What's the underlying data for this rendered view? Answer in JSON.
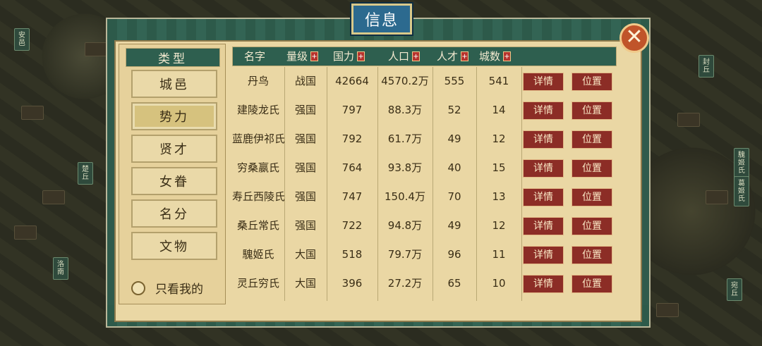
{
  "title": "信息",
  "close_icon": "close-icon",
  "sidebar": {
    "header": "类型",
    "categories": [
      "城邑",
      "势力",
      "贤才",
      "女眷",
      "名分",
      "文物"
    ],
    "active": "势力",
    "only_mine_label": "只看我的"
  },
  "table": {
    "columns": [
      {
        "label": "名字",
        "sortable": false
      },
      {
        "label": "量级",
        "sortable": true
      },
      {
        "label": "国力",
        "sortable": true
      },
      {
        "label": "人口",
        "sortable": true
      },
      {
        "label": "人才",
        "sortable": true
      },
      {
        "label": "城数",
        "sortable": true
      }
    ],
    "sort_symbol": "+",
    "detail_label": "详情",
    "location_label": "位置",
    "rows": [
      {
        "name": "丹鸟",
        "level": "战国",
        "power": "42664",
        "population": "4570.2万",
        "talent": "555",
        "cities": "541"
      },
      {
        "name": "建陵龙氏",
        "level": "强国",
        "power": "797",
        "population": "88.3万",
        "talent": "52",
        "cities": "14"
      },
      {
        "name": "蓝鹿伊祁氏",
        "level": "强国",
        "power": "792",
        "population": "61.7万",
        "talent": "49",
        "cities": "12"
      },
      {
        "name": "穷桑嬴氏",
        "level": "强国",
        "power": "764",
        "population": "93.8万",
        "talent": "40",
        "cities": "15"
      },
      {
        "name": "寿丘西陵氏",
        "level": "强国",
        "power": "747",
        "population": "150.4万",
        "talent": "70",
        "cities": "13"
      },
      {
        "name": "桑丘常氏",
        "level": "强国",
        "power": "722",
        "population": "94.8万",
        "talent": "49",
        "cities": "12"
      },
      {
        "name": "騩姬氏",
        "level": "大国",
        "power": "518",
        "population": "79.7万",
        "talent": "96",
        "cities": "11"
      },
      {
        "name": "灵丘穷氏",
        "level": "大国",
        "power": "396",
        "population": "27.2万",
        "talent": "65",
        "cities": "10"
      }
    ]
  },
  "map_labels": [
    "封丘",
    "騩姬氏",
    "葛姬氏",
    "宛丘",
    "洛南",
    "安邑",
    "楚丘"
  ]
}
